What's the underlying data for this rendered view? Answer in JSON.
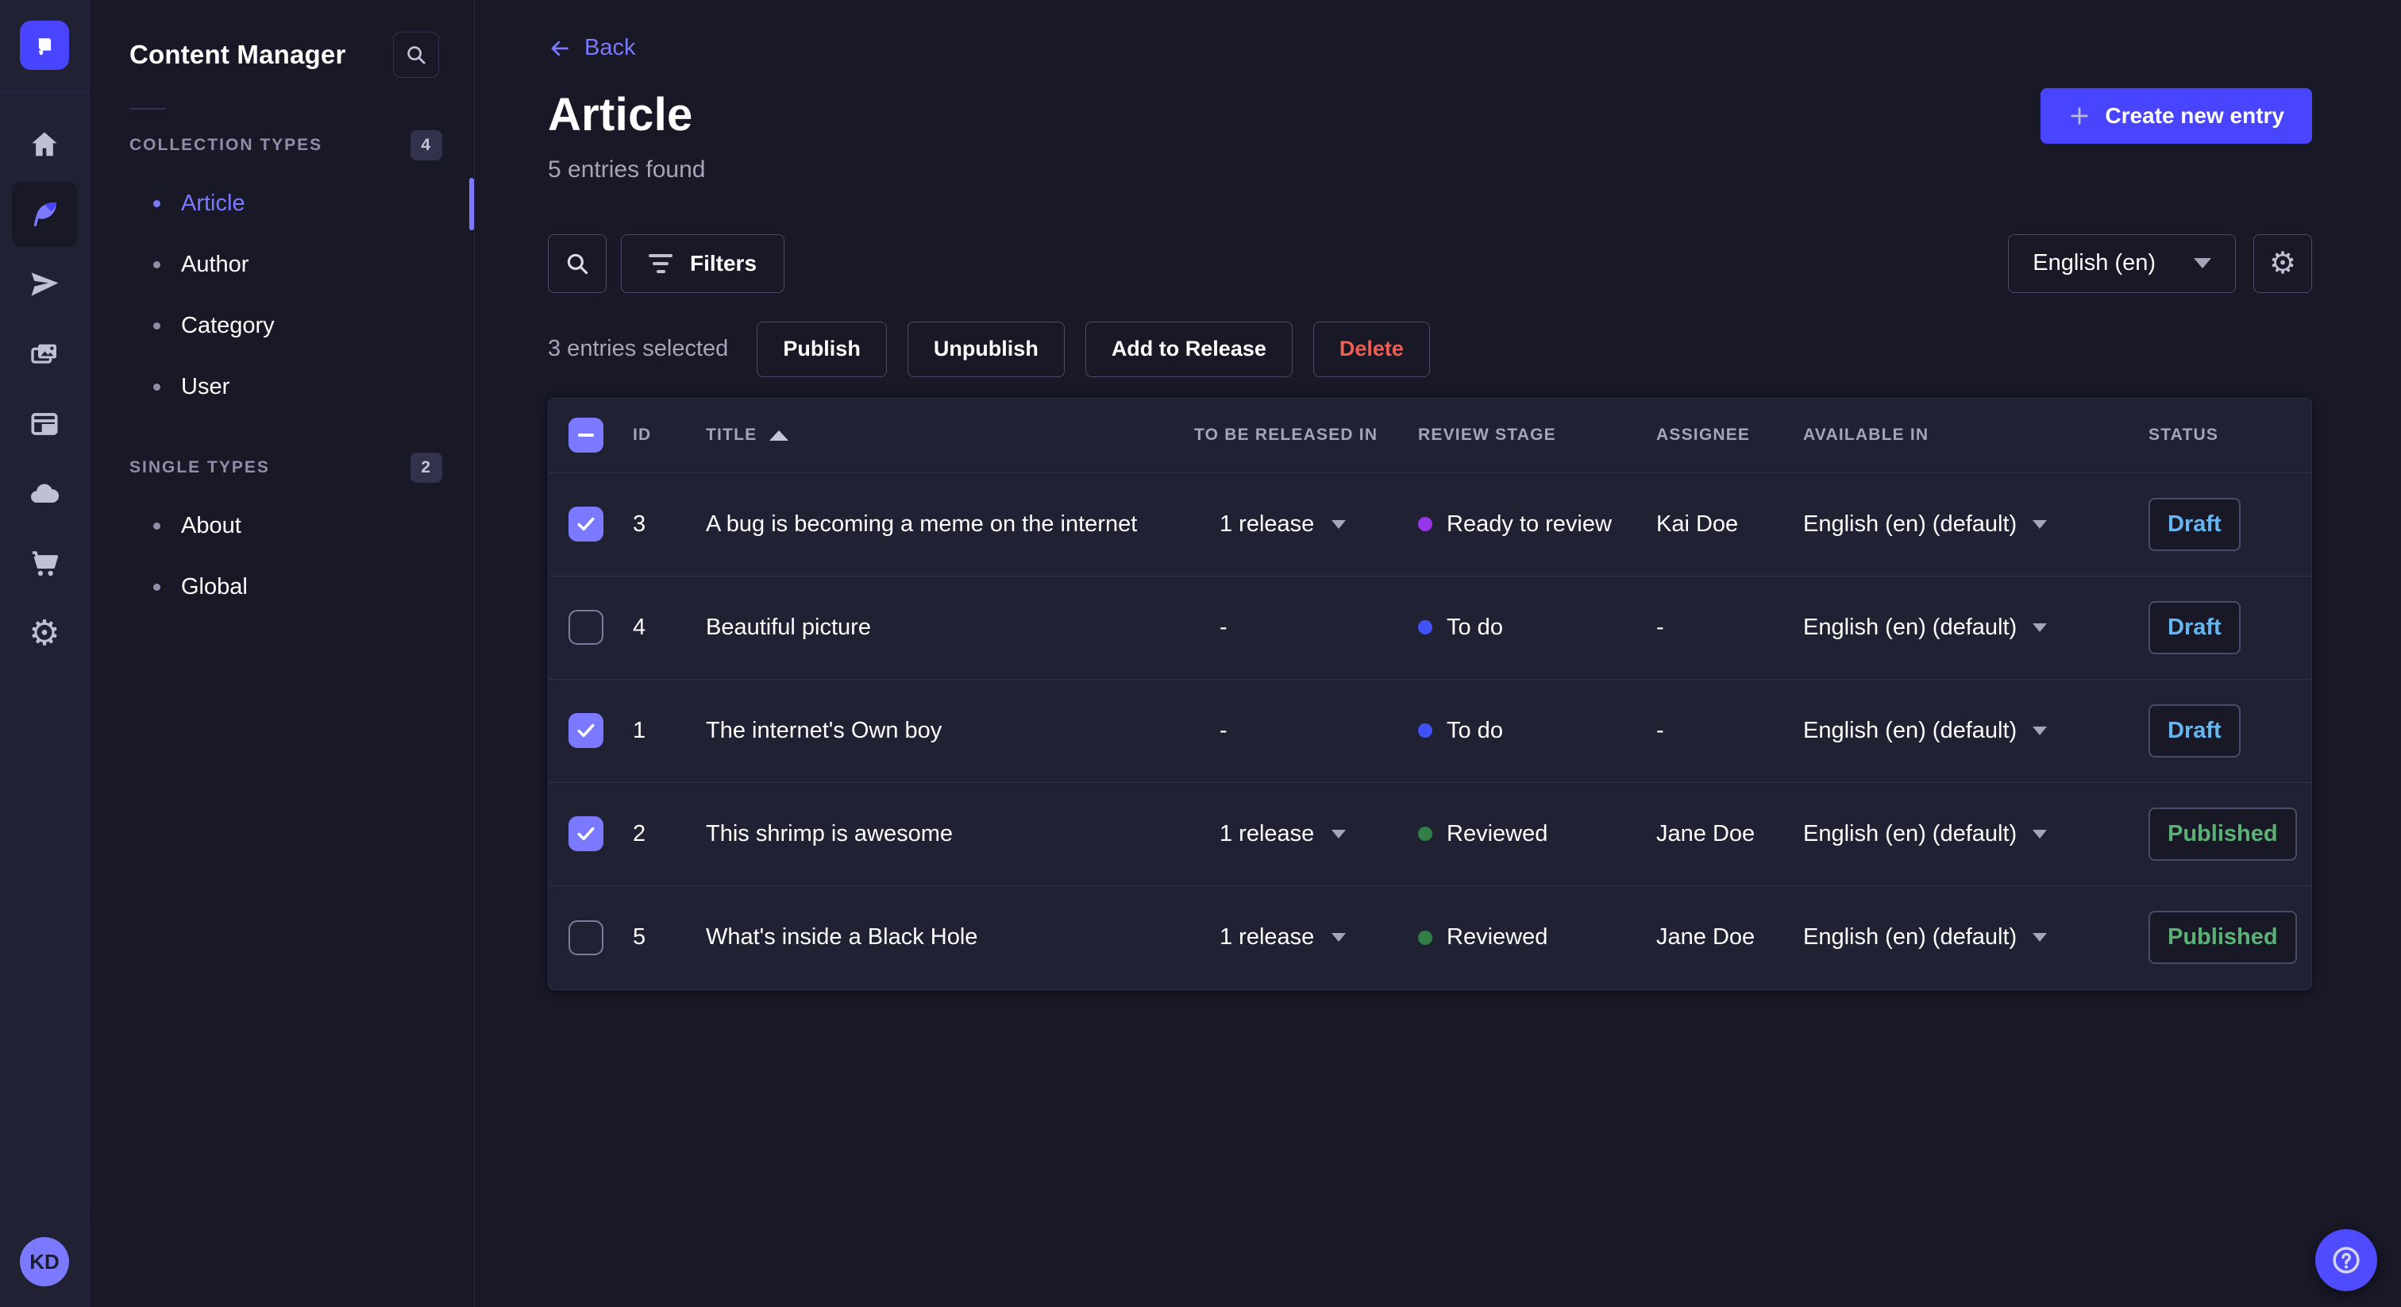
{
  "colors": {
    "primary": "#4945ff",
    "primary_light": "#7b79ff",
    "background": "#181826",
    "surface": "#212134",
    "border": "#32324d",
    "text_secondary": "#a5a5ba",
    "draft_text": "#66b7f1",
    "published_text": "#5cb176",
    "danger_text": "#ee5e52",
    "stage_todo": "#4152f5",
    "stage_ready_to_review": "#9736e8",
    "stage_reviewed": "#328048"
  },
  "rail": {
    "icons": [
      "strapi-logo",
      "home",
      "content-manager-feather",
      "releases-paper-plane",
      "media-library-images",
      "content-type-builder-layout",
      "cloud",
      "marketplace-cart",
      "settings-gear"
    ],
    "active_icon": "content-manager-feather",
    "avatar_initials": "KD"
  },
  "subnav": {
    "title": "Content Manager",
    "search_icon": "search-icon",
    "sections": [
      {
        "label": "COLLECTION TYPES",
        "count": "4",
        "items": [
          {
            "label": "Article",
            "active": true
          },
          {
            "label": "Author",
            "active": false
          },
          {
            "label": "Category",
            "active": false
          },
          {
            "label": "User",
            "active": false
          }
        ]
      },
      {
        "label": "SINGLE TYPES",
        "count": "2",
        "items": [
          {
            "label": "About",
            "active": false
          },
          {
            "label": "Global",
            "active": false
          }
        ]
      }
    ]
  },
  "header": {
    "back_label": "Back",
    "title": "Article",
    "subtitle": "5 entries found",
    "create_label": "Create new entry"
  },
  "toolbar": {
    "search_icon": "search-icon",
    "filters_label": "Filters",
    "locale_value": "English (en)",
    "settings_icon": "gear-icon"
  },
  "selection": {
    "label": "3 entries selected",
    "publish_label": "Publish",
    "unpublish_label": "Unpublish",
    "add_to_release_label": "Add to Release",
    "delete_label": "Delete"
  },
  "table": {
    "headers": {
      "id": "ID",
      "title": "TITLE",
      "release": "TO BE RELEASED IN",
      "review": "REVIEW STAGE",
      "assignee": "ASSIGNEE",
      "available": "AVAILABLE IN",
      "status": "STATUS"
    },
    "sort": {
      "column": "TITLE",
      "direction": "ascending"
    },
    "header_checkbox_state": "indeterminate",
    "rows": [
      {
        "checked": true,
        "id": "3",
        "title": "A bug is becoming a meme on the internet",
        "release": "1 release",
        "review_stage": "Ready to review",
        "stage_type": "ready",
        "assignee": "Kai Doe",
        "available": "English (en) (default)",
        "status": "Draft"
      },
      {
        "checked": false,
        "id": "4",
        "title": "Beautiful picture",
        "release": "-",
        "review_stage": "To do",
        "stage_type": "todo",
        "assignee": "-",
        "available": "English (en) (default)",
        "status": "Draft"
      },
      {
        "checked": true,
        "id": "1",
        "title": "The internet's Own boy",
        "release": "-",
        "review_stage": "To do",
        "stage_type": "todo",
        "assignee": "-",
        "available": "English (en) (default)",
        "status": "Draft"
      },
      {
        "checked": true,
        "id": "2",
        "title": "This shrimp is awesome",
        "release": "1 release",
        "review_stage": "Reviewed",
        "stage_type": "reviewed",
        "assignee": "Jane Doe",
        "available": "English (en) (default)",
        "status": "Published"
      },
      {
        "checked": false,
        "id": "5",
        "title": "What's inside a Black Hole",
        "release": "1 release",
        "review_stage": "Reviewed",
        "stage_type": "reviewed",
        "assignee": "Jane Doe",
        "available": "English (en) (default)",
        "status": "Published"
      }
    ]
  },
  "fab": {
    "icon": "help-question-mark"
  }
}
